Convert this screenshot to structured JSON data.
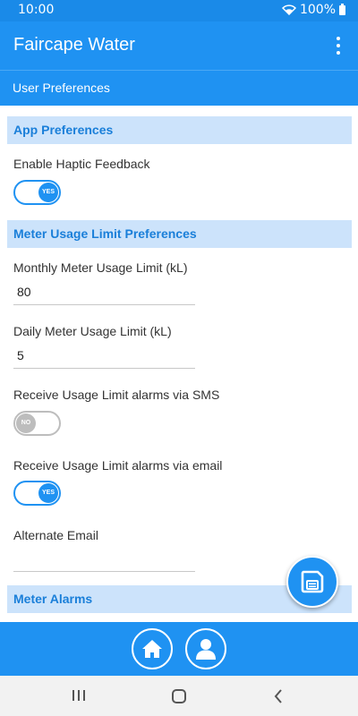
{
  "status_bar": {
    "time": "10:00",
    "battery": "100%"
  },
  "app_bar": {
    "title": "Faircape Water",
    "menu_icon": "more-vert-icon"
  },
  "sub_bar": {
    "title": "User Preferences"
  },
  "sections": {
    "app_preferences": {
      "header": "App Preferences",
      "haptic_label": "Enable Haptic Feedback",
      "haptic_toggle": "YES"
    },
    "meter_usage": {
      "header": "Meter Usage Limit Preferences",
      "monthly_label": "Monthly Meter Usage Limit (kL)",
      "monthly_value": "80",
      "daily_label": "Daily Meter Usage Limit (kL)",
      "daily_value": "5",
      "sms_label": "Receive Usage Limit alarms via SMS",
      "sms_toggle": "NO",
      "email_label": "Receive Usage Limit alarms via email",
      "email_toggle": "YES",
      "alt_email_label": "Alternate Email",
      "alt_email_value": ""
    },
    "meter_alarms": {
      "header": "Meter Alarms"
    }
  },
  "fab": {
    "icon": "save-icon"
  },
  "bottom_nav": {
    "home_icon": "home-icon",
    "profile_icon": "person-icon"
  },
  "colors": {
    "primary": "#1f92f2",
    "section_bg": "#cce3fb",
    "section_text": "#1a7fd9",
    "toggle_off": "#bdbdbd"
  }
}
